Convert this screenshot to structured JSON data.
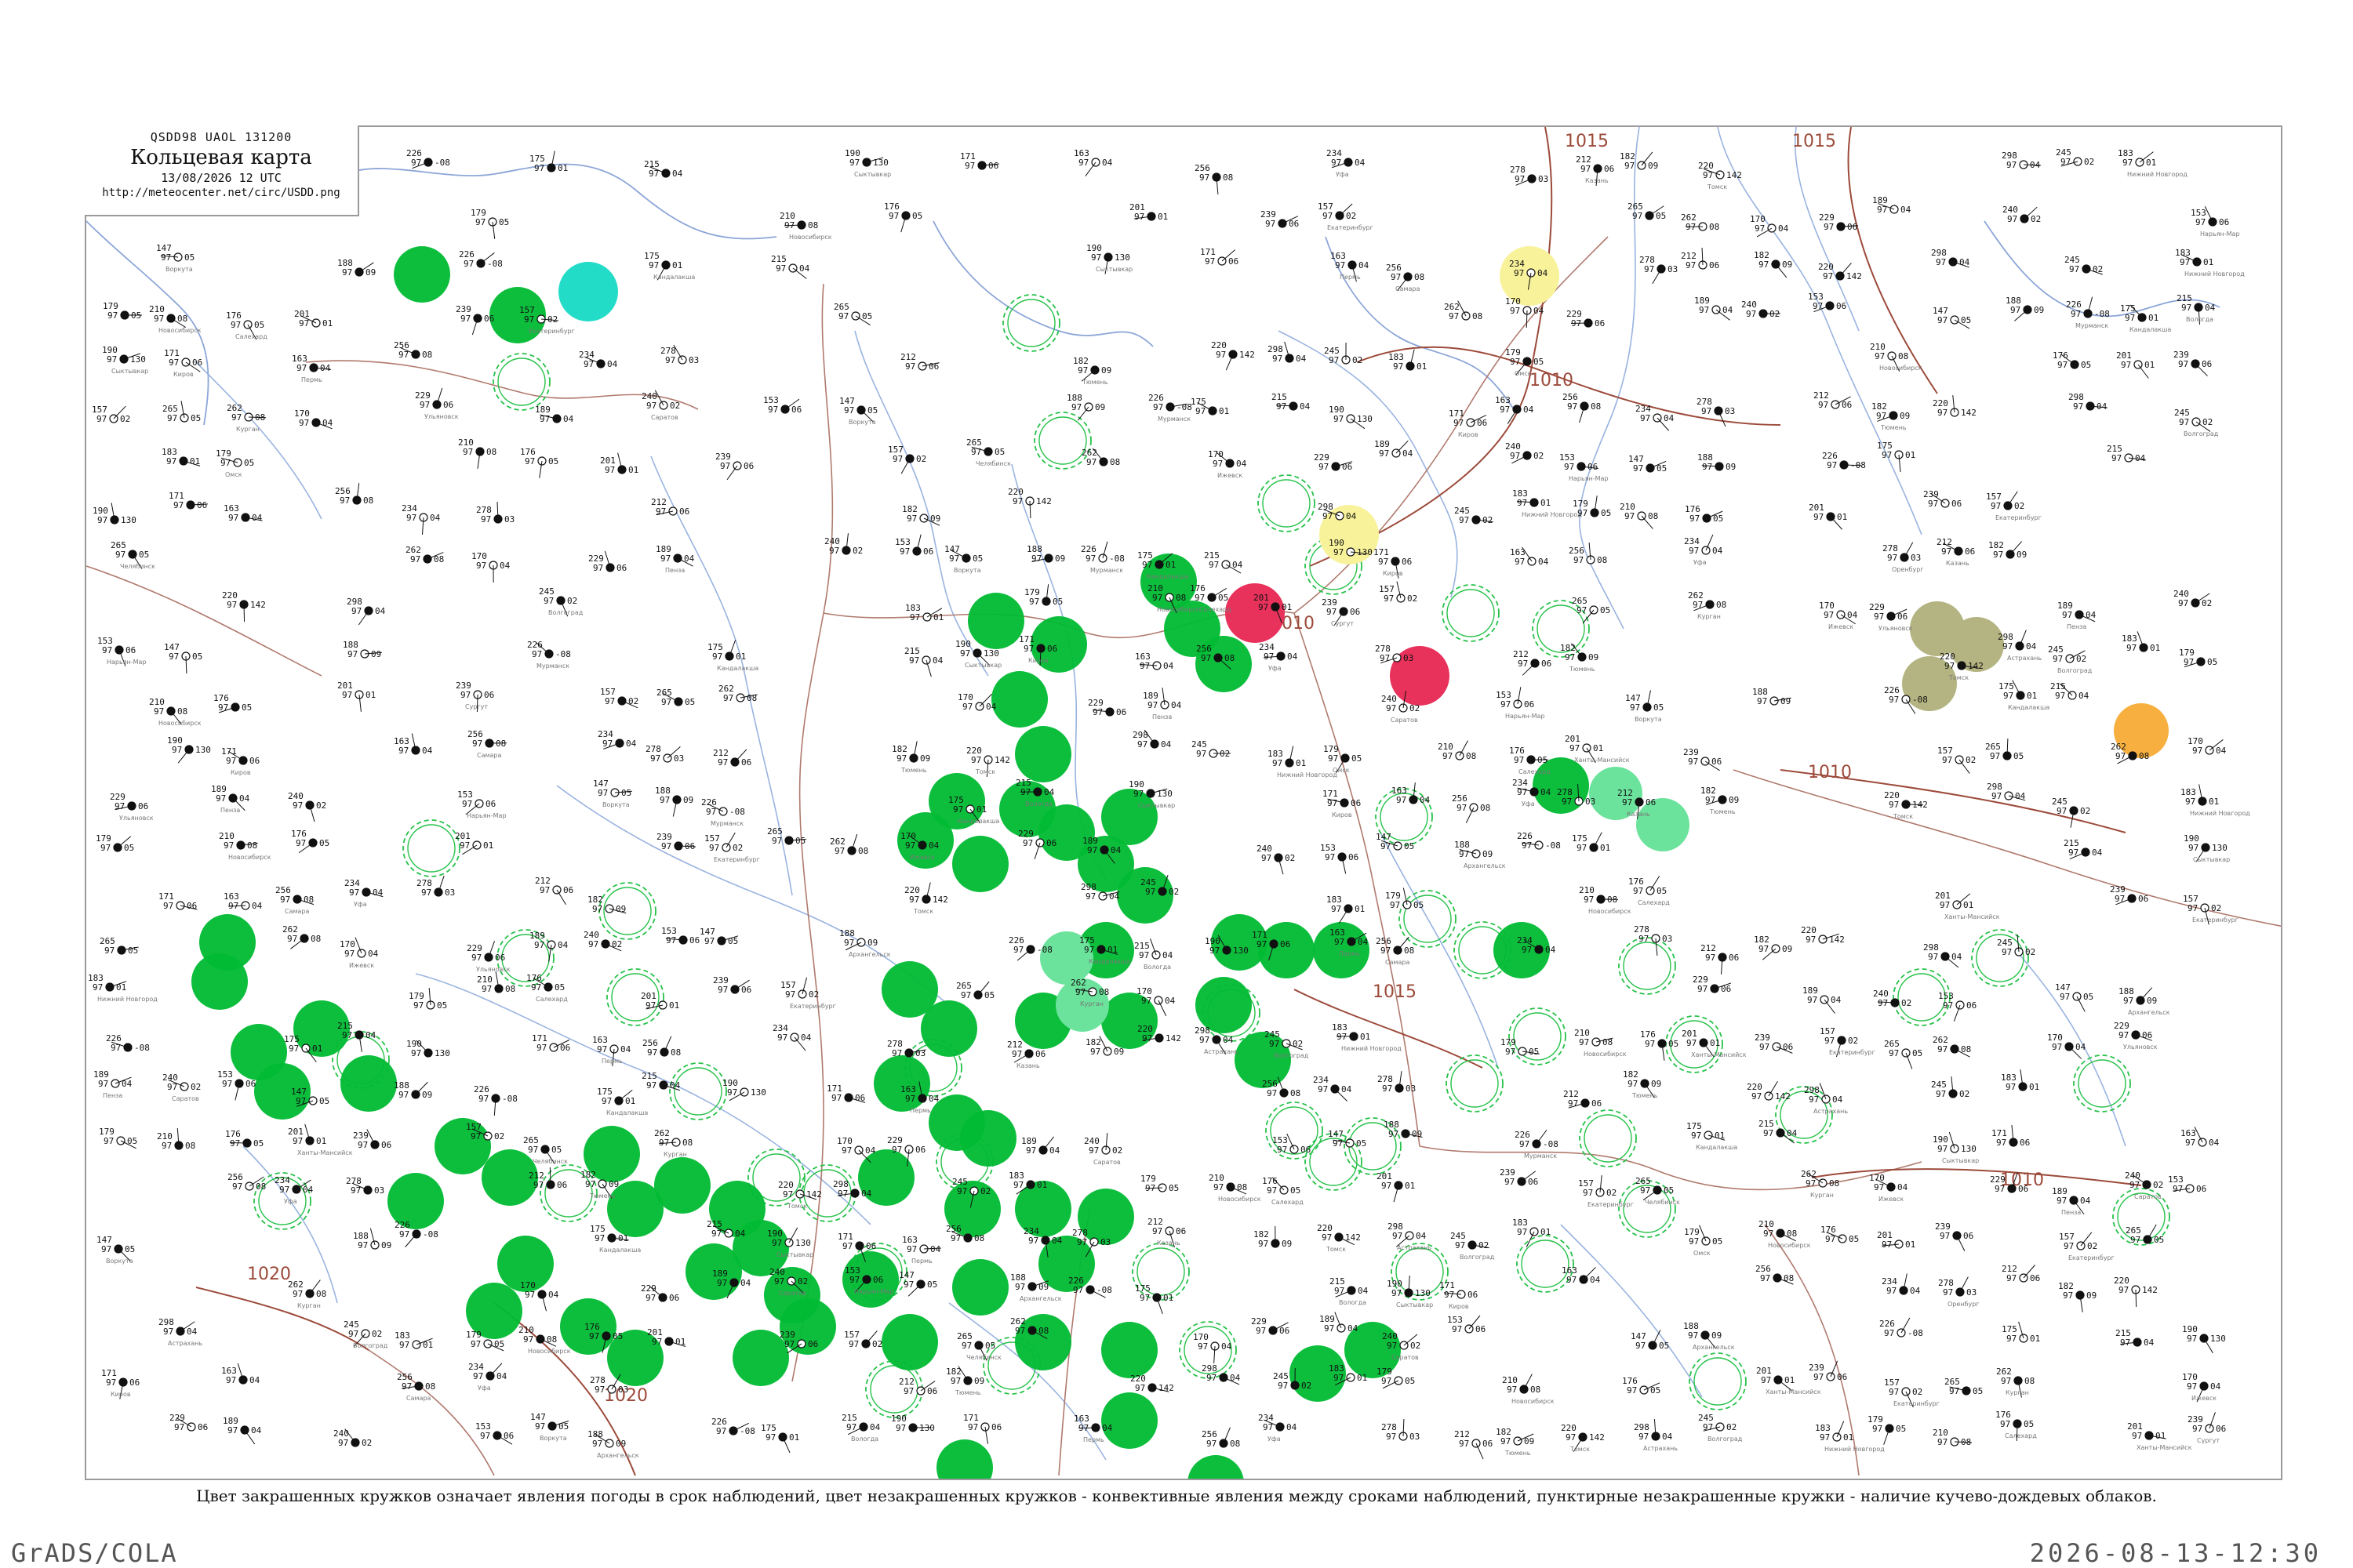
{
  "header": {
    "code_line": "QSDD98  UAOL  131200",
    "title": "Кольцевая карта",
    "date_line": "13/08/2026 12 UTC",
    "url": "http://meteocenter.net/circ/USDD.png"
  },
  "caption": "Цвет закрашенных кружков означает явления погоды в срок наблюдений, цвет незакрашенных кружков - конвективные явления между сроками наблюдений, пунктирные незакрашенные кружки - наличие кучево-дождевых облаков.",
  "footer": {
    "left": "GrADS/COLA",
    "right": "2026-08-13-12:30"
  },
  "isobars": [
    {
      "label": "1015",
      "pos": "top-center"
    },
    {
      "label": "1015",
      "pos": "top-right"
    },
    {
      "label": "1010",
      "pos": "center-right"
    },
    {
      "label": "1010",
      "pos": "right"
    },
    {
      "label": "1010",
      "pos": "bottom-right"
    },
    {
      "label": "1020",
      "pos": "bottom-left"
    },
    {
      "label": "1020",
      "pos": "top-left"
    },
    {
      "label": "1015",
      "pos": "center"
    },
    {
      "label": "1010",
      "pos": "upper-center"
    }
  ],
  "colors": {
    "thunderstorm": "#00bb33",
    "rain_halo": "#27c24a",
    "cyan_event": "#22dcc8",
    "yellow_event": "#f8f29a",
    "red_event": "#e8325c",
    "olive_event": "#b4b482",
    "orange_event": "#f7b040",
    "light_green_event": "#6ce39c",
    "river": "#7fa0d8",
    "coast": "#8ca6d8",
    "border": "#b07a6e",
    "isobar": "#9c4a3a"
  },
  "stations": [
    {
      "t": "226",
      "p": "97",
      "d": "-08",
      "n": "Мурманск"
    },
    {
      "t": "175",
      "p": "97",
      "d": "01",
      "n": "Кандалакша"
    },
    {
      "t": "215",
      "p": "97",
      "d": "04",
      "n": "Вологда"
    },
    {
      "t": "190",
      "p": "97",
      "d": "130",
      "n": "Сыктывкар"
    },
    {
      "t": "171",
      "p": "97",
      "d": "06",
      "n": "Киров"
    },
    {
      "t": "163",
      "p": "97",
      "d": "04",
      "n": "Пермь"
    },
    {
      "t": "256",
      "p": "97",
      "d": "08",
      "n": "Самара"
    },
    {
      "t": "234",
      "p": "97",
      "d": "04",
      "n": "Уфа"
    },
    {
      "t": "278",
      "p": "97",
      "d": "03",
      "n": "Оренбург"
    },
    {
      "t": "212",
      "p": "97",
      "d": "06",
      "n": "Казань"
    },
    {
      "t": "182",
      "p": "97",
      "d": "09",
      "n": "Тюмень"
    },
    {
      "t": "220",
      "p": "97",
      "d": "142",
      "n": "Томск"
    },
    {
      "t": "298",
      "p": "97",
      "d": "04",
      "n": "Астрахань"
    },
    {
      "t": "245",
      "p": "97",
      "d": "02",
      "n": "Волгоград"
    },
    {
      "t": "183",
      "p": "97",
      "d": "01",
      "n": "Нижний Новгород"
    },
    {
      "t": "179",
      "p": "97",
      "d": "05",
      "n": "Омск"
    },
    {
      "t": "210",
      "p": "97",
      "d": "08",
      "n": "Новосибирск"
    },
    {
      "t": "176",
      "p": "97",
      "d": "05",
      "n": "Салехард"
    },
    {
      "t": "201",
      "p": "97",
      "d": "01",
      "n": "Ханты-Мансийск"
    },
    {
      "t": "239",
      "p": "97",
      "d": "06",
      "n": "Сургут"
    },
    {
      "t": "157",
      "p": "97",
      "d": "02",
      "n": "Екатеринбург"
    },
    {
      "t": "265",
      "p": "97",
      "d": "05",
      "n": "Челябинск"
    },
    {
      "t": "262",
      "p": "97",
      "d": "08",
      "n": "Курган"
    },
    {
      "t": "170",
      "p": "97",
      "d": "04",
      "n": "Ижевск"
    },
    {
      "t": "229",
      "p": "97",
      "d": "06",
      "n": "Ульяновск"
    },
    {
      "t": "189",
      "p": "97",
      "d": "04",
      "n": "Пенза"
    },
    {
      "t": "240",
      "p": "97",
      "d": "02",
      "n": "Саратов"
    },
    {
      "t": "153",
      "p": "97",
      "d": "06",
      "n": "Нарьян-Мар"
    },
    {
      "t": "147",
      "p": "97",
      "d": "05",
      "n": "Воркута"
    },
    {
      "t": "188",
      "p": "97",
      "d": "09",
      "n": "Архангельск"
    }
  ]
}
